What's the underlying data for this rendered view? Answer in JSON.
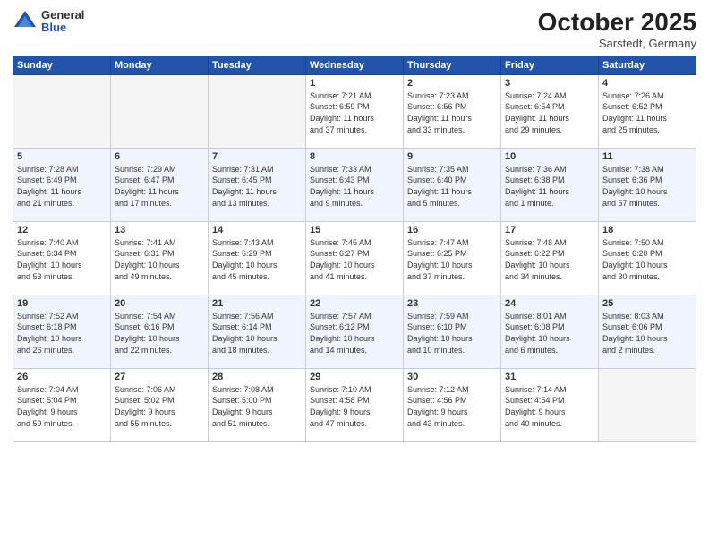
{
  "header": {
    "logo_general": "General",
    "logo_blue": "Blue",
    "month": "October 2025",
    "location": "Sarstedt, Germany"
  },
  "days_of_week": [
    "Sunday",
    "Monday",
    "Tuesday",
    "Wednesday",
    "Thursday",
    "Friday",
    "Saturday"
  ],
  "weeks": [
    [
      {
        "day": "",
        "info": ""
      },
      {
        "day": "",
        "info": ""
      },
      {
        "day": "",
        "info": ""
      },
      {
        "day": "1",
        "info": "Sunrise: 7:21 AM\nSunset: 6:59 PM\nDaylight: 11 hours\nand 37 minutes."
      },
      {
        "day": "2",
        "info": "Sunrise: 7:23 AM\nSunset: 6:56 PM\nDaylight: 11 hours\nand 33 minutes."
      },
      {
        "day": "3",
        "info": "Sunrise: 7:24 AM\nSunset: 6:54 PM\nDaylight: 11 hours\nand 29 minutes."
      },
      {
        "day": "4",
        "info": "Sunrise: 7:26 AM\nSunset: 6:52 PM\nDaylight: 11 hours\nand 25 minutes."
      }
    ],
    [
      {
        "day": "5",
        "info": "Sunrise: 7:28 AM\nSunset: 6:49 PM\nDaylight: 11 hours\nand 21 minutes."
      },
      {
        "day": "6",
        "info": "Sunrise: 7:29 AM\nSunset: 6:47 PM\nDaylight: 11 hours\nand 17 minutes."
      },
      {
        "day": "7",
        "info": "Sunrise: 7:31 AM\nSunset: 6:45 PM\nDaylight: 11 hours\nand 13 minutes."
      },
      {
        "day": "8",
        "info": "Sunrise: 7:33 AM\nSunset: 6:43 PM\nDaylight: 11 hours\nand 9 minutes."
      },
      {
        "day": "9",
        "info": "Sunrise: 7:35 AM\nSunset: 6:40 PM\nDaylight: 11 hours\nand 5 minutes."
      },
      {
        "day": "10",
        "info": "Sunrise: 7:36 AM\nSunset: 6:38 PM\nDaylight: 11 hours\nand 1 minute."
      },
      {
        "day": "11",
        "info": "Sunrise: 7:38 AM\nSunset: 6:36 PM\nDaylight: 10 hours\nand 57 minutes."
      }
    ],
    [
      {
        "day": "12",
        "info": "Sunrise: 7:40 AM\nSunset: 6:34 PM\nDaylight: 10 hours\nand 53 minutes."
      },
      {
        "day": "13",
        "info": "Sunrise: 7:41 AM\nSunset: 6:31 PM\nDaylight: 10 hours\nand 49 minutes."
      },
      {
        "day": "14",
        "info": "Sunrise: 7:43 AM\nSunset: 6:29 PM\nDaylight: 10 hours\nand 45 minutes."
      },
      {
        "day": "15",
        "info": "Sunrise: 7:45 AM\nSunset: 6:27 PM\nDaylight: 10 hours\nand 41 minutes."
      },
      {
        "day": "16",
        "info": "Sunrise: 7:47 AM\nSunset: 6:25 PM\nDaylight: 10 hours\nand 37 minutes."
      },
      {
        "day": "17",
        "info": "Sunrise: 7:48 AM\nSunset: 6:22 PM\nDaylight: 10 hours\nand 34 minutes."
      },
      {
        "day": "18",
        "info": "Sunrise: 7:50 AM\nSunset: 6:20 PM\nDaylight: 10 hours\nand 30 minutes."
      }
    ],
    [
      {
        "day": "19",
        "info": "Sunrise: 7:52 AM\nSunset: 6:18 PM\nDaylight: 10 hours\nand 26 minutes."
      },
      {
        "day": "20",
        "info": "Sunrise: 7:54 AM\nSunset: 6:16 PM\nDaylight: 10 hours\nand 22 minutes."
      },
      {
        "day": "21",
        "info": "Sunrise: 7:56 AM\nSunset: 6:14 PM\nDaylight: 10 hours\nand 18 minutes."
      },
      {
        "day": "22",
        "info": "Sunrise: 7:57 AM\nSunset: 6:12 PM\nDaylight: 10 hours\nand 14 minutes."
      },
      {
        "day": "23",
        "info": "Sunrise: 7:59 AM\nSunset: 6:10 PM\nDaylight: 10 hours\nand 10 minutes."
      },
      {
        "day": "24",
        "info": "Sunrise: 8:01 AM\nSunset: 6:08 PM\nDaylight: 10 hours\nand 6 minutes."
      },
      {
        "day": "25",
        "info": "Sunrise: 8:03 AM\nSunset: 6:06 PM\nDaylight: 10 hours\nand 2 minutes."
      }
    ],
    [
      {
        "day": "26",
        "info": "Sunrise: 7:04 AM\nSunset: 5:04 PM\nDaylight: 9 hours\nand 59 minutes."
      },
      {
        "day": "27",
        "info": "Sunrise: 7:06 AM\nSunset: 5:02 PM\nDaylight: 9 hours\nand 55 minutes."
      },
      {
        "day": "28",
        "info": "Sunrise: 7:08 AM\nSunset: 5:00 PM\nDaylight: 9 hours\nand 51 minutes."
      },
      {
        "day": "29",
        "info": "Sunrise: 7:10 AM\nSunset: 4:58 PM\nDaylight: 9 hours\nand 47 minutes."
      },
      {
        "day": "30",
        "info": "Sunrise: 7:12 AM\nSunset: 4:56 PM\nDaylight: 9 hours\nand 43 minutes."
      },
      {
        "day": "31",
        "info": "Sunrise: 7:14 AM\nSunset: 4:54 PM\nDaylight: 9 hours\nand 40 minutes."
      },
      {
        "day": "",
        "info": ""
      }
    ]
  ]
}
